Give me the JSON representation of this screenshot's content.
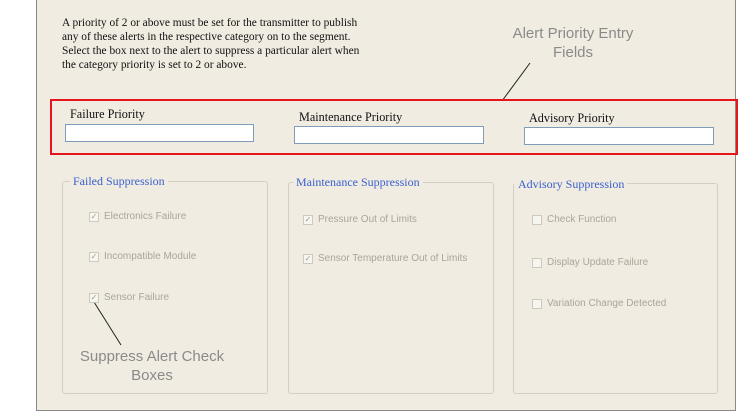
{
  "instructions": "A priority of 2 or above must be set for the transmitter to publish\nany of these alerts in the respective category on to the segment.\nSelect the box next to the alert to suppress a particular alert when\nthe category priority is set to 2 or above.",
  "callouts": {
    "alert_priority_entry_fields": "Alert Priority Entry\nFields",
    "suppress_alert_check_boxes": "Suppress Alert Check\nBoxes"
  },
  "priority_fields": [
    {
      "label": "Failure Priority",
      "value": ""
    },
    {
      "label": "Maintenance Priority",
      "value": ""
    },
    {
      "label": "Advisory Priority",
      "value": ""
    }
  ],
  "groups": [
    {
      "title": "Failed Suppression",
      "items": [
        {
          "label": "Electronics Failure",
          "checked": true
        },
        {
          "label": "Incompatible Module",
          "checked": true
        },
        {
          "label": "Sensor Failure",
          "checked": true
        }
      ]
    },
    {
      "title": "Maintenance Suppression",
      "items": [
        {
          "label": "Pressure Out of Limits",
          "checked": true
        },
        {
          "label": "Sensor Temperature Out of Limits",
          "checked": true
        }
      ]
    },
    {
      "title": "Advisory Suppression",
      "items": [
        {
          "label": "Check Function",
          "checked": false
        },
        {
          "label": "Display Update Failure",
          "checked": false
        },
        {
          "label": "Variation Change Detected",
          "checked": false
        }
      ]
    }
  ],
  "colors": {
    "panel_background": "#f0ece1",
    "group_title": "#3a5fcd",
    "highlight_border": "#e4181c",
    "disabled_text": "#a9a59b",
    "callout_text": "#8a8a8a"
  }
}
